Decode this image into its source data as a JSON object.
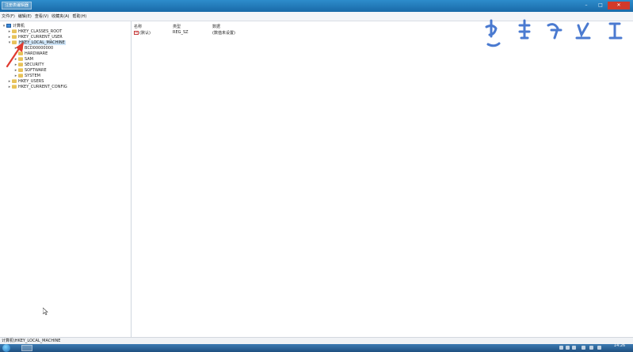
{
  "window": {
    "title": "注册表编辑器",
    "minimize": "–",
    "maximize": "□",
    "close": "✕"
  },
  "menu": [
    {
      "label": "文件(F)"
    },
    {
      "label": "编辑(E)"
    },
    {
      "label": "查看(V)"
    },
    {
      "label": "收藏夹(A)"
    },
    {
      "label": "帮助(H)"
    }
  ],
  "tree": {
    "root": "计算机",
    "nodes": [
      {
        "label": "HKEY_CLASSES_ROOT"
      },
      {
        "label": "HKEY_CURRENT_USER"
      },
      {
        "label": "HKEY_LOCAL_MACHINE",
        "selected": true
      },
      {
        "label": "BCD00000000"
      },
      {
        "label": "HARDWARE"
      },
      {
        "label": "SAM"
      },
      {
        "label": "SECURITY"
      },
      {
        "label": "SOFTWARE"
      },
      {
        "label": "SYSTEM"
      },
      {
        "label": "HKEY_USERS"
      },
      {
        "label": "HKEY_CURRENT_CONFIG"
      }
    ]
  },
  "list": {
    "columns": [
      "名称",
      "类型",
      "数据"
    ],
    "rows": [
      {
        "name": "(默认)",
        "type": "REG_SZ",
        "data": "(数值未设置)",
        "icon": "ab"
      }
    ]
  },
  "status": {
    "path": "计算机\\HKEY_LOCAL_MACHINE"
  },
  "taskbar": {
    "clock_time": "14:26"
  },
  "colors": {
    "titlebar": "#1a6aa8",
    "selection": "#cde4f7",
    "arrow": "#e03a2f",
    "watermark": "#2b63c8"
  }
}
